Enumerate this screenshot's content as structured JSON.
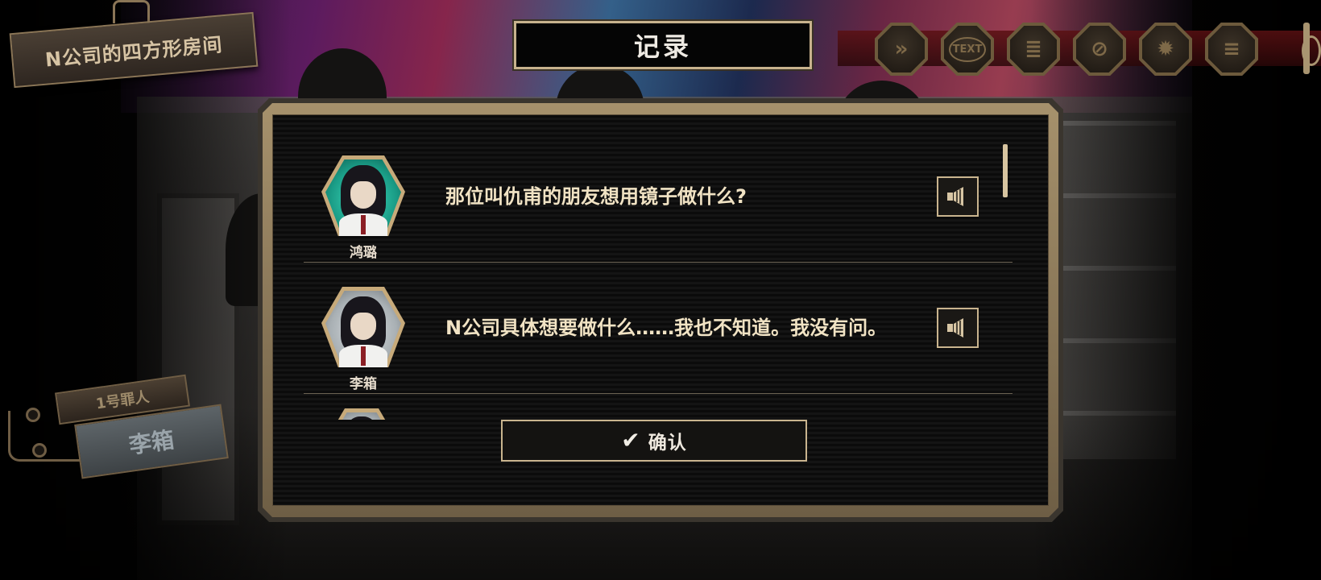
{
  "location": {
    "name": "N公司的四方形房间"
  },
  "log_title": "记录",
  "toolbar": [
    {
      "icon": "fast-forward-icon",
      "glyph": "»"
    },
    {
      "icon": "text-icon",
      "glyph": "TEXT"
    },
    {
      "icon": "notebook-icon",
      "glyph": "≣"
    },
    {
      "icon": "prohibited-icon",
      "glyph": "⊘"
    },
    {
      "icon": "gear-icon",
      "glyph": "✹"
    },
    {
      "icon": "menu-icon",
      "glyph": "≡"
    }
  ],
  "prisoner": {
    "number_label": "1号罪人",
    "name": "李箱"
  },
  "log_entries": [
    {
      "speaker": "鸿璐",
      "text": "那位叫仇甫的朋友想用镜子做什么?",
      "avatar_color": "teal"
    },
    {
      "speaker": "李箱",
      "text": "N公司具体想要做什么……我也不知道。我没有问。",
      "avatar_color": "grey"
    }
  ],
  "confirm_button": {
    "label": "确认"
  },
  "colors": {
    "accent_gold": "#c9b48e",
    "text_cream": "#f1e3c4",
    "panel_bg": "#0b0b0b"
  }
}
